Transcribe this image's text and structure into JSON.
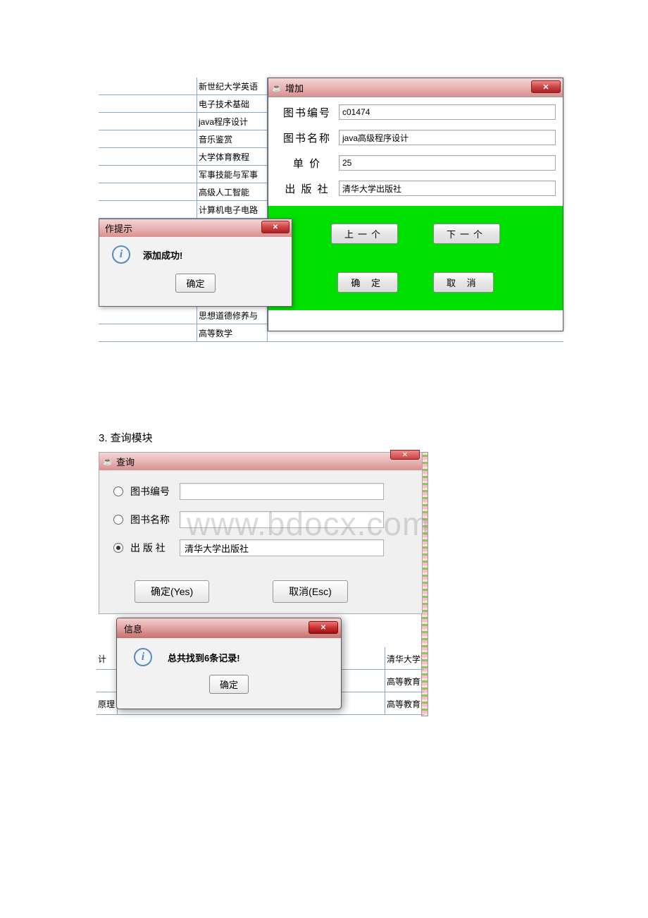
{
  "bg_rows": [
    "新世纪大学英语",
    "电子技术基础",
    "java程序设计",
    "音乐鉴赏",
    "大学体育教程",
    "军事技能与军事",
    "高级人工智能",
    "计算机电子电路",
    "",
    "",
    "",
    "",
    "",
    "思想道德修养与",
    "高等数学"
  ],
  "add_dialog": {
    "title": "增加",
    "fields": {
      "book_id": {
        "label": "图书编号",
        "value": "c01474"
      },
      "book_name": {
        "label": "图书名称",
        "value": "java高级程序设计"
      },
      "price": {
        "label": "单    价",
        "value": "25"
      },
      "publisher": {
        "label": "出 版 社",
        "value": "清华大学出版社"
      }
    },
    "buttons": {
      "prev": "上一个",
      "next": "下一个",
      "ok": "确  定",
      "cancel": "取  消"
    }
  },
  "msg_dialog": {
    "title": "作提示",
    "text": "添加成功!",
    "ok": "确定"
  },
  "section_title": "3. 查询模块",
  "query_dialog": {
    "title": "查询",
    "options": {
      "book_id": {
        "label": "图书编号",
        "value": ""
      },
      "book_name": {
        "label": "图书名称",
        "value": ""
      },
      "publisher": {
        "label": "出 版 社",
        "value": "清华大学出版社"
      }
    },
    "ok": "确定(Yes)",
    "cancel": "取消(Esc)"
  },
  "q_bg_rows": [
    {
      "c1": "计",
      "c3": "清华大学"
    },
    {
      "c1": "",
      "c3": "高等教育"
    },
    {
      "c1": "原理",
      "c3": "高等教育"
    }
  ],
  "info_dialog2": {
    "title": "信息",
    "text": "总共找到6条记录!",
    "ok": "确定"
  },
  "watermark": "www.bdocx.com"
}
